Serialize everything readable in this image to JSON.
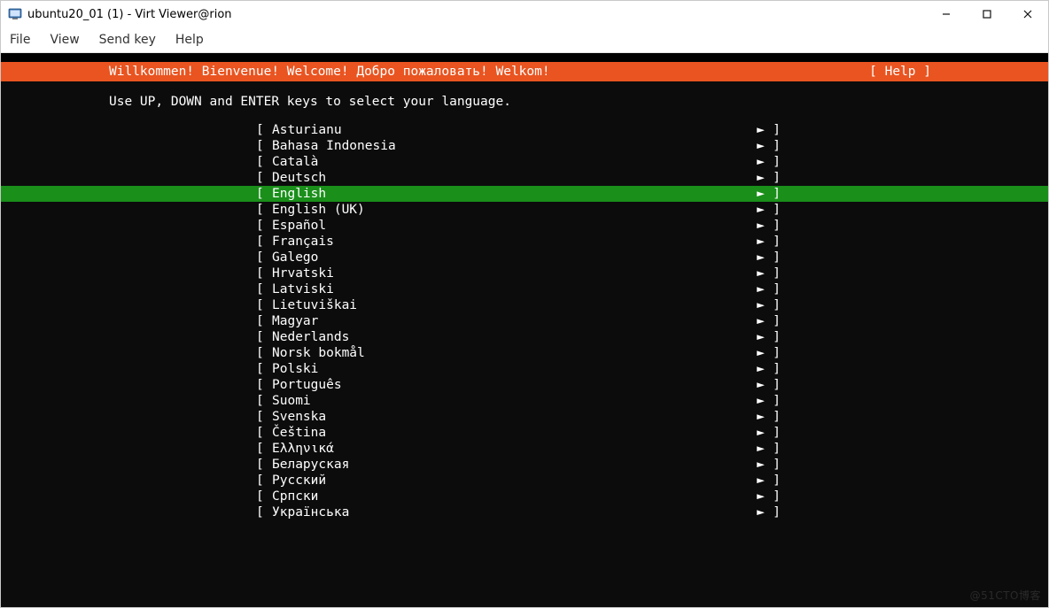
{
  "window": {
    "title": "ubuntu20_01 (1) - Virt Viewer@rion"
  },
  "menu": {
    "file": "File",
    "view": "View",
    "sendkey": "Send key",
    "help": "Help"
  },
  "installer": {
    "welcome": "Willkommen! Bienvenue! Welcome! Добро пожаловать! Welkom!",
    "help_label": "[ Help ]",
    "instruction": "Use UP, DOWN and ENTER keys to select your language.",
    "selected_index": 4,
    "languages": [
      "Asturianu",
      "Bahasa Indonesia",
      "Català",
      "Deutsch",
      "English",
      "English (UK)",
      "Español",
      "Français",
      "Galego",
      "Hrvatski",
      "Latviski",
      "Lietuviškai",
      "Magyar",
      "Nederlands",
      "Norsk bokmål",
      "Polski",
      "Português",
      "Suomi",
      "Svenska",
      "Čeština",
      "Ελληνικά",
      "Беларуская",
      "Русский",
      "Српски",
      "Українська"
    ]
  },
  "glyphs": {
    "left_bracket": "[ ",
    "right_bracket": " ]",
    "arrow": "►"
  },
  "watermark": "@51CTO博客"
}
